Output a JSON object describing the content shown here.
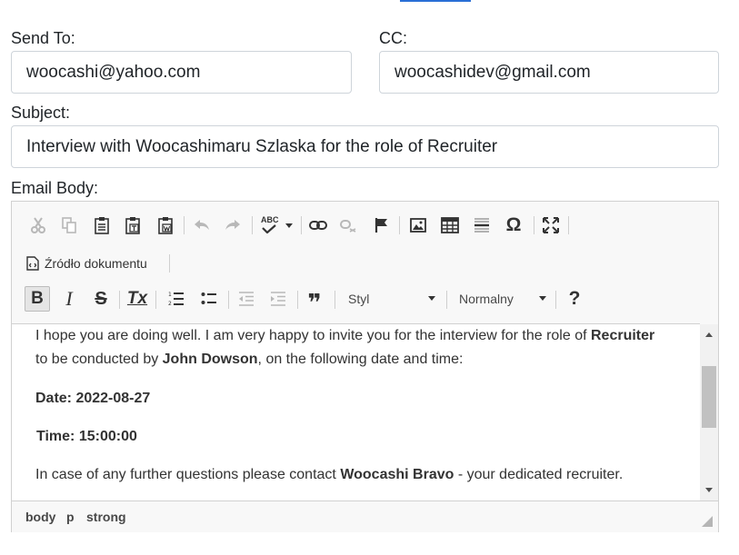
{
  "form": {
    "send_to_label": "Send To:",
    "send_to_value": "woocashi@yahoo.com",
    "cc_label": "CC:",
    "cc_value": "woocashidev@gmail.com",
    "subject_label": "Subject:",
    "subject_value": "Interview with Woocashimaru Szlaska for the role of Recruiter",
    "body_label": "Email Body:"
  },
  "toolbar": {
    "source_label": "Źródło dokumentu",
    "style_label": "Styl",
    "format_label": "Normalny",
    "spellcheck_glyph": "ABC",
    "omega_glyph": "Ω",
    "help_glyph": "?",
    "bold_glyph": "B",
    "italic_glyph": "I",
    "strike_glyph": "S",
    "remove_format_glyph": "Tx",
    "blockquote_glyph": "❞"
  },
  "editor": {
    "line1_prefix": "I hope you are doing well. I am very happy to invite you for the interview for the role of ",
    "line1_bold": "Recruiter",
    "line2_prefix": "to be conducted by ",
    "line2_bold": "John Dowson",
    "line2_suffix": ", on the following date and time:",
    "date_line": "Date: 2022-08-27",
    "time_line": "Time: 15:00:00",
    "contact_prefix": "In case of any further questions please contact ",
    "contact_bold": "Woocashi Bravo",
    "contact_suffix": " - your dedicated recruiter."
  },
  "pathbar": {
    "items": [
      "body",
      "p",
      "strong"
    ]
  },
  "colors": {
    "link_accent": "#2a6fd6",
    "border": "#ced4da",
    "toolbar_bg": "#f8f8f8"
  }
}
